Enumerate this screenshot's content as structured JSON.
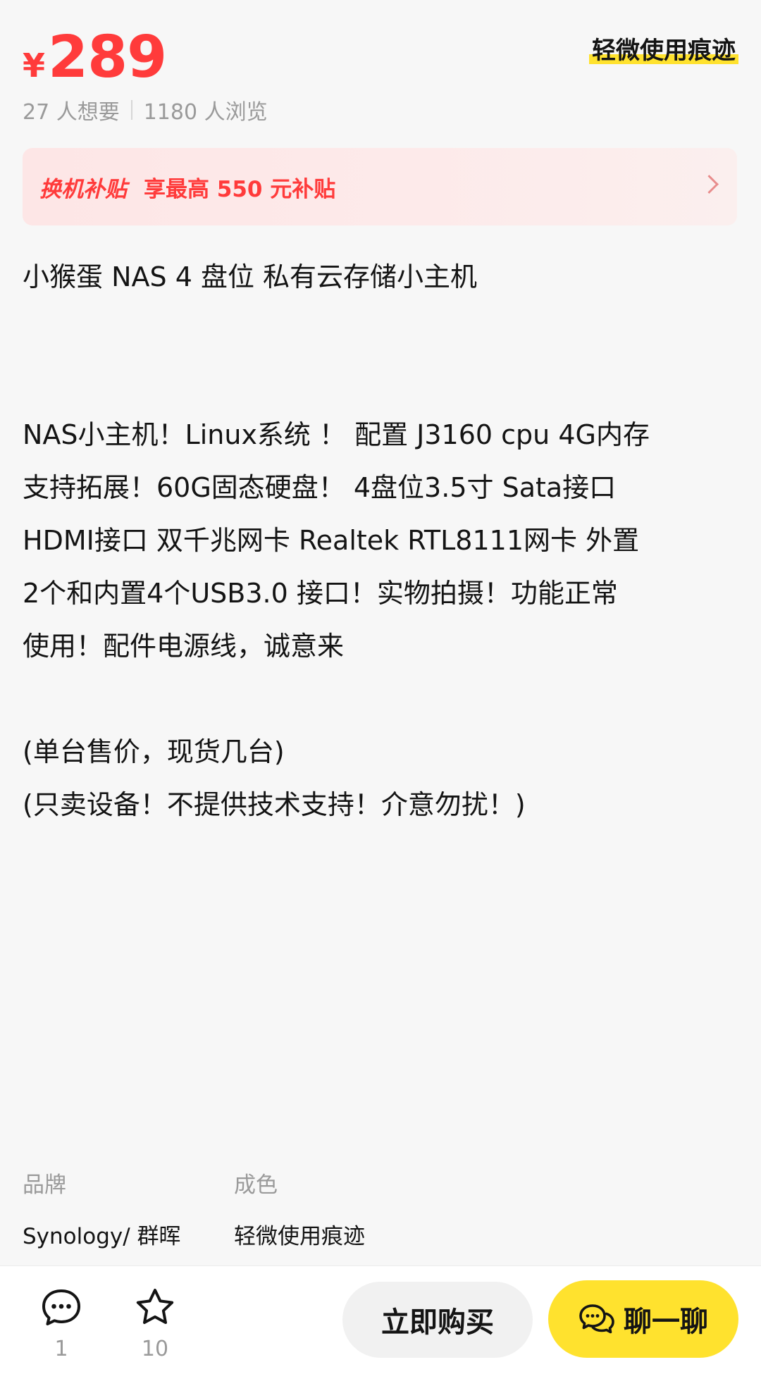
{
  "price": {
    "currency": "¥",
    "value": "289",
    "color": "#ff3b3b"
  },
  "condition_tag": "轻微使用痕迹",
  "stats": {
    "wants": "27 人想要",
    "views": "1180 人浏览"
  },
  "subsidy": {
    "tag": "换机补贴",
    "text": "享最高 550 元补贴"
  },
  "title": "小猴蛋 NAS 4 盘位 私有云存储小主机",
  "description": [
    "NAS小主机！Linux系统 ！ 配置 J3160 cpu  4G内存",
    "支持拓展！60G固态硬盘！ 4盘位3.5寸 Sata接口",
    "HDMI接口  双千兆网卡  Realtek RTL8111网卡  外置",
    "2个和内置4个USB3.0 接口！实物拍摄！功能正常",
    "使用！配件电源线，诚意来"
  ],
  "notes": [
    "(单台售价，现货几台)",
    "(只卖设备！不提供技术支持！介意勿扰！)"
  ],
  "attributes": [
    {
      "label": "品牌",
      "value": "Synology/ 群晖"
    },
    {
      "label": "成色",
      "value": "轻微使用痕迹"
    }
  ],
  "bottom_bar": {
    "comments_count": "1",
    "favorites_count": "10",
    "buy_label": "立即购买",
    "chat_label": "聊一聊",
    "chat_color": "#ffe22e"
  },
  "icons": {
    "comment": "comment-bubble-icon",
    "favorite": "star-icon",
    "chat": "chat-bubbles-icon",
    "arrow": "chevron-right-icon"
  }
}
